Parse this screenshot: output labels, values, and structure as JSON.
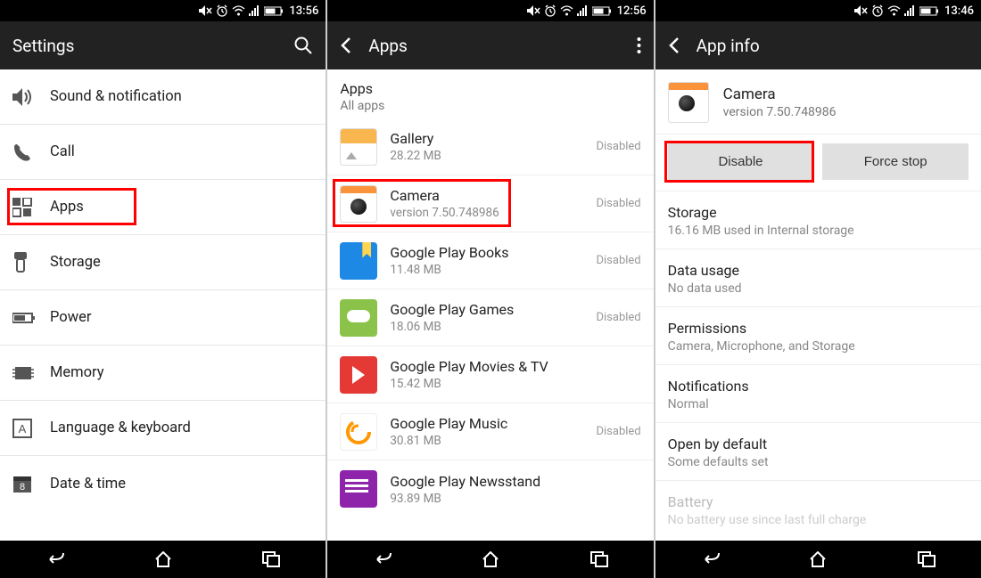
{
  "screens": {
    "s1": {
      "status_time": "13:56",
      "title": "Settings",
      "items": [
        {
          "label": "Sound & notification"
        },
        {
          "label": "Call"
        },
        {
          "label": "Apps"
        },
        {
          "label": "Storage"
        },
        {
          "label": "Power"
        },
        {
          "label": "Memory"
        },
        {
          "label": "Language & keyboard"
        },
        {
          "label": "Date & time"
        }
      ]
    },
    "s2": {
      "status_time": "12:56",
      "title": "Apps",
      "section_title": "Apps",
      "section_sub": "All apps",
      "apps": [
        {
          "name": "Gallery",
          "sub": "28.22 MB",
          "status": "Disabled"
        },
        {
          "name": "Camera",
          "sub": "version 7.50.748986",
          "status": "Disabled"
        },
        {
          "name": "Google Play Books",
          "sub": "11.48 MB",
          "status": "Disabled"
        },
        {
          "name": "Google Play Games",
          "sub": "18.06 MB",
          "status": "Disabled"
        },
        {
          "name": "Google Play Movies & TV",
          "sub": "15.42 MB",
          "status": ""
        },
        {
          "name": "Google Play Music",
          "sub": "30.81 MB",
          "status": "Disabled"
        },
        {
          "name": "Google Play Newsstand",
          "sub": "93.89 MB",
          "status": ""
        }
      ]
    },
    "s3": {
      "status_time": "13:46",
      "title": "App info",
      "app_name": "Camera",
      "app_version": "version 7.50.748986",
      "btn_disable": "Disable",
      "btn_force_stop": "Force stop",
      "info": [
        {
          "title": "Storage",
          "sub": "16.16 MB used in Internal storage"
        },
        {
          "title": "Data usage",
          "sub": "No data used"
        },
        {
          "title": "Permissions",
          "sub": "Camera, Microphone, and Storage"
        },
        {
          "title": "Notifications",
          "sub": "Normal"
        },
        {
          "title": "Open by default",
          "sub": "Some defaults set"
        },
        {
          "title": "Battery",
          "sub": "No battery use since last full charge"
        }
      ]
    }
  }
}
